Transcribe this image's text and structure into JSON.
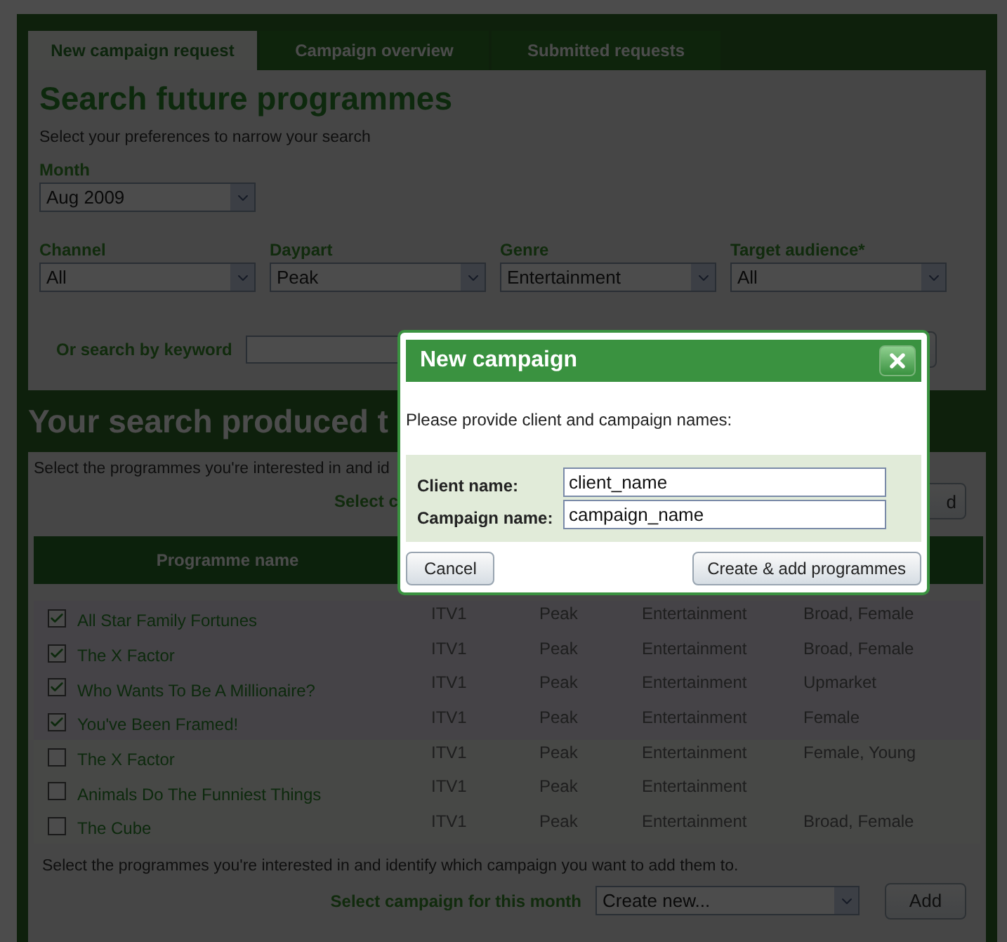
{
  "tabs": [
    {
      "label": "New campaign request",
      "selected": true
    },
    {
      "label": "Campaign overview",
      "selected": false
    },
    {
      "label": "Submitted requests",
      "selected": false
    }
  ],
  "search": {
    "title": "Search future programmes",
    "subtitle": "Select your preferences to narrow your search",
    "month": {
      "label": "Month",
      "value": "Aug 2009"
    },
    "filters": [
      {
        "label": "Channel",
        "value": "All"
      },
      {
        "label": "Daypart",
        "value": "Peak"
      },
      {
        "label": "Genre",
        "value": "Entertainment"
      },
      {
        "label": "Target audience*",
        "value": "All"
      }
    ],
    "keyword": {
      "label": "Or search by keyword"
    }
  },
  "results": {
    "title": "Your search produced t",
    "instructions": "Select the programmes you're interested in and id",
    "campaign_label": "Select c",
    "add_button": "d",
    "table": {
      "columns": [
        "Programme name"
      ],
      "rows": [
        {
          "selected": true,
          "name": "All Star Family Fortunes",
          "channel": "ITV1",
          "daypart": "Peak",
          "genre": "Entertainment",
          "audience": "Broad, Female"
        },
        {
          "selected": true,
          "name": "The X Factor",
          "channel": "ITV1",
          "daypart": "Peak",
          "genre": "Entertainment",
          "audience": "Broad, Female"
        },
        {
          "selected": true,
          "name": "Who Wants To Be A Millionaire?",
          "channel": "ITV1",
          "daypart": "Peak",
          "genre": "Entertainment",
          "audience": "Upmarket"
        },
        {
          "selected": true,
          "name": "You've Been Framed!",
          "channel": "ITV1",
          "daypart": "Peak",
          "genre": "Entertainment",
          "audience": "Female"
        },
        {
          "selected": false,
          "name": "The X Factor",
          "channel": "ITV1",
          "daypart": "Peak",
          "genre": "Entertainment",
          "audience": "Female, Young"
        },
        {
          "selected": false,
          "name": "Animals Do The Funniest Things",
          "channel": "ITV1",
          "daypart": "Peak",
          "genre": "Entertainment"
        },
        {
          "selected": false,
          "name": "The Cube",
          "channel": "ITV1",
          "daypart": "Peak",
          "genre": "Entertainment",
          "audience": "Broad, Female"
        }
      ]
    },
    "footer": {
      "instructions": "Select the programmes you're interested in and identify which campaign you want to add them to.",
      "campaign_label": "Select campaign for this month",
      "campaign_value": "Create new...",
      "add_button": "Add"
    }
  },
  "dialog": {
    "title": "New campaign",
    "intro": "Please provide client and campaign names:",
    "fields": [
      {
        "label": "Client name:",
        "value": "client_name"
      },
      {
        "label": "Campaign name:",
        "value": "campaign_name"
      }
    ],
    "buttons": [
      {
        "kind": "cancel",
        "label": "Cancel"
      },
      {
        "kind": "confirm",
        "label": "Create & add programmes"
      }
    ]
  }
}
